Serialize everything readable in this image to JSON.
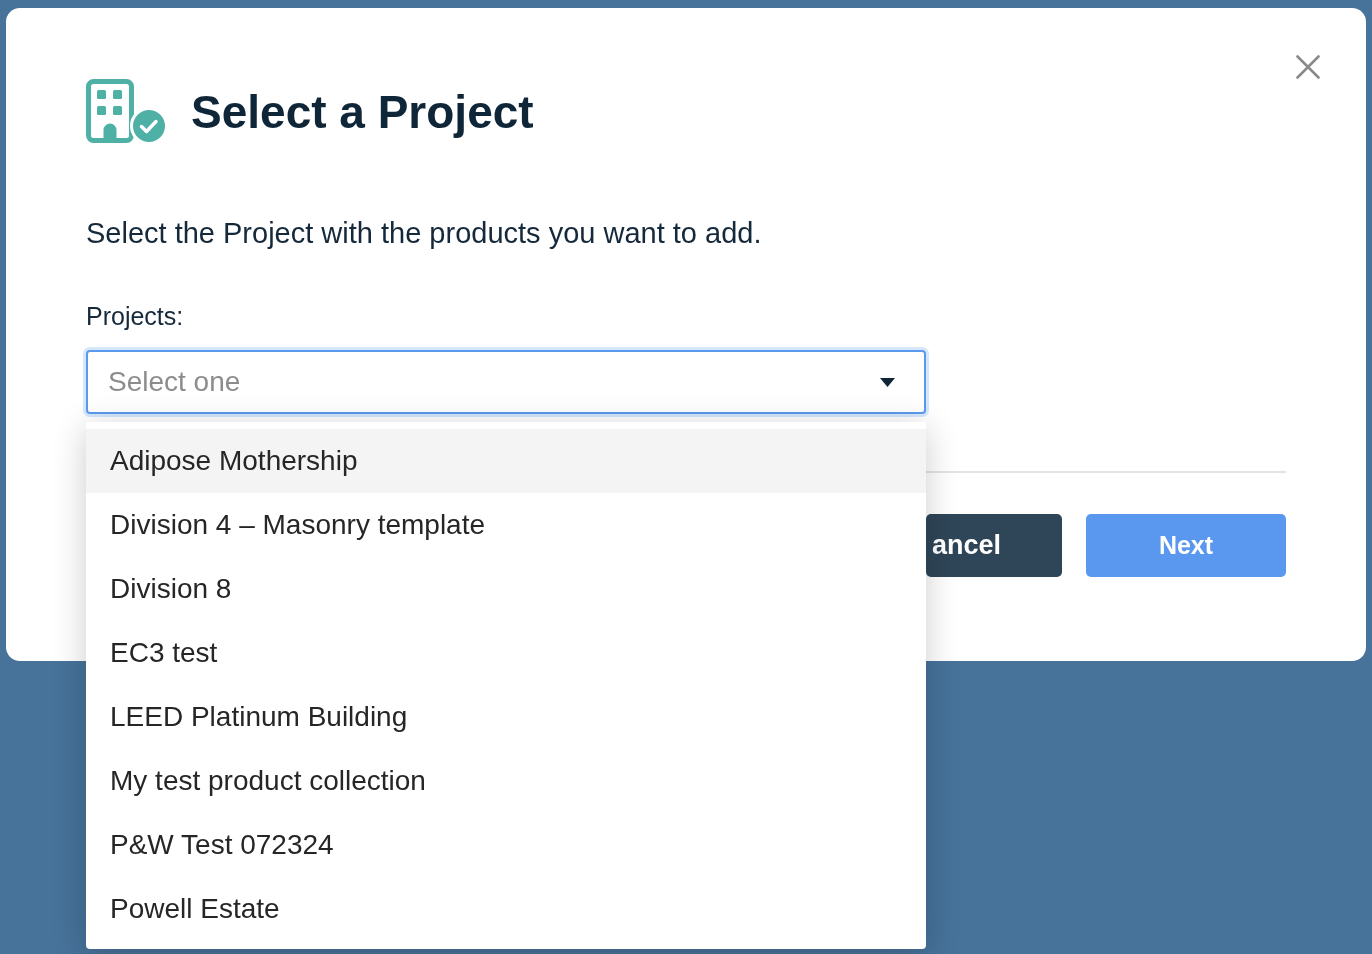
{
  "dialog": {
    "title": "Select a Project",
    "description": "Select the Project with the products you want to add."
  },
  "field": {
    "label": "Projects:",
    "placeholder": "Select one",
    "expanded": true
  },
  "options": [
    {
      "label": "Adipose Mothership",
      "highlighted": true
    },
    {
      "label": "Division 4 – Masonry template",
      "highlighted": false
    },
    {
      "label": "Division 8",
      "highlighted": false
    },
    {
      "label": "EC3 test",
      "highlighted": false
    },
    {
      "label": "LEED Platinum Building",
      "highlighted": false
    },
    {
      "label": "My test product collection",
      "highlighted": false
    },
    {
      "label": "P&W Test 072324",
      "highlighted": false
    },
    {
      "label": "Powell Estate",
      "highlighted": false
    }
  ],
  "buttons": [
    {
      "label": "ancel",
      "kind": "secondary"
    },
    {
      "label": "Next",
      "kind": "primary"
    }
  ]
}
